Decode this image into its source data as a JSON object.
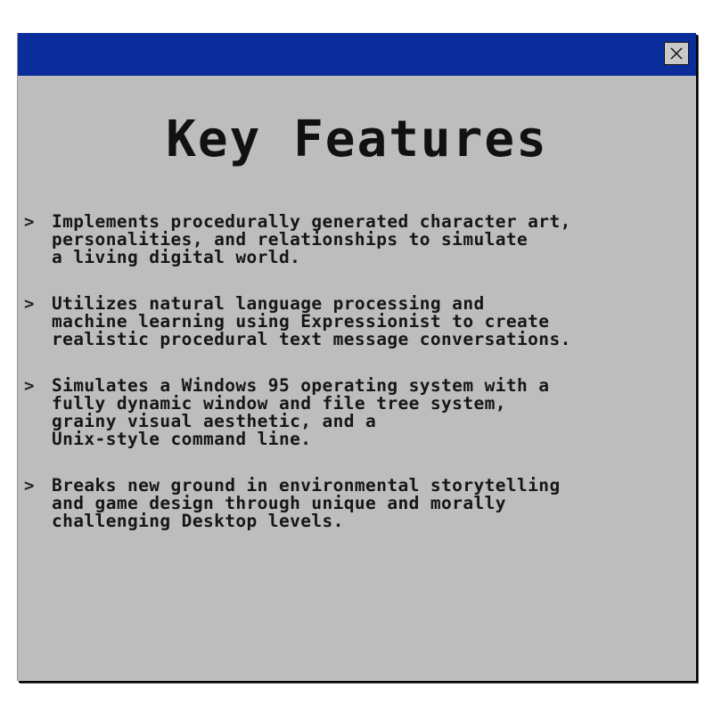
{
  "window": {
    "heading": "Key Features",
    "close_icon": "close-x-icon"
  },
  "features": {
    "bullet": ">",
    "items": [
      {
        "text": "Implements procedurally generated character art,\npersonalities, and relationships to simulate\na living digital world."
      },
      {
        "text": "Utilizes natural language processing and\nmachine learning using Expressionist to create\nrealistic procedural text message conversations."
      },
      {
        "text": "Simulates a Windows 95 operating system with a\nfully dynamic window and file tree system,\ngrainy visual aesthetic, and a\nUnix-style command line."
      },
      {
        "text": "Breaks new ground in environmental storytelling\nand game design through unique and morally\nchallenging Desktop levels."
      }
    ]
  },
  "colors": {
    "titlebar": "#0a2d9b",
    "window_bg": "#bdbdbd",
    "text": "#161616"
  }
}
